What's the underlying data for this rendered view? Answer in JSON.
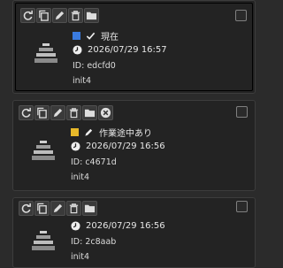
{
  "colors": {
    "panel_bg": "#232323",
    "page_bg": "#2b2b2b",
    "status_current": "#3a7be0",
    "status_wip": "#e8b92a"
  },
  "toolbar_icons": [
    "refresh-icon",
    "copy-icon",
    "edit-icon",
    "trash-icon",
    "folder-icon",
    "close-circle-icon"
  ],
  "snapshots": [
    {
      "status_label": "現在",
      "status_color": "#3a7be0",
      "status_icon": "checkmark-icon",
      "time": "2026/07/29 16:57",
      "id": "ID: edcfd0",
      "name": "init4"
    },
    {
      "status_label": "作業途中あり",
      "status_color": "#e8b92a",
      "status_icon": "pencil-icon",
      "time": "2026/07/29 16:56",
      "id": "ID: c4671d",
      "name": "init4"
    },
    {
      "status_label": "",
      "time": "2026/07/29 16:56",
      "id": "ID: 2c8aab",
      "name": "init4"
    }
  ]
}
